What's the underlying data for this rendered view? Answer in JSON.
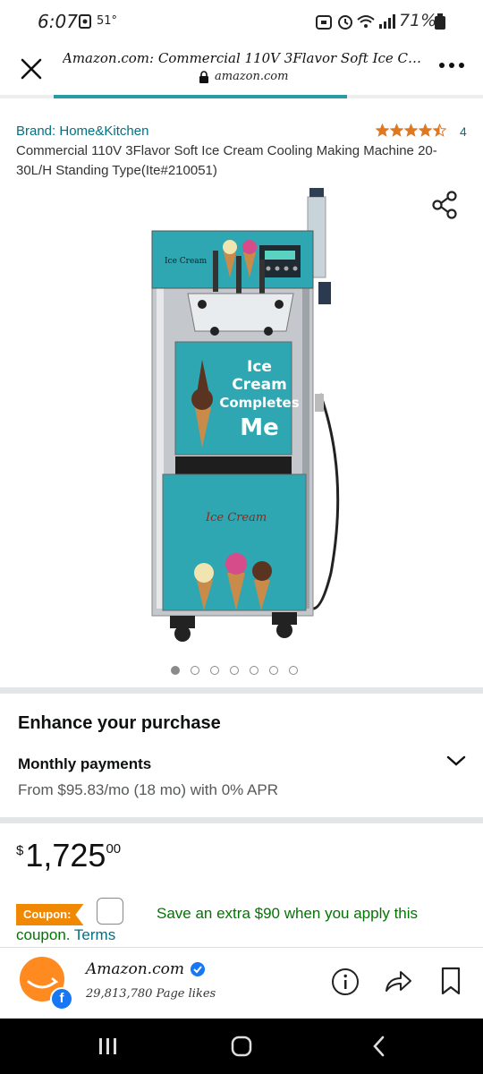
{
  "status_bar": {
    "time": "6:07",
    "temperature": "51°",
    "battery": "71%"
  },
  "browser": {
    "page_title": "Amazon.com: Commercial 110V 3Flavor Soft Ice Cream C...",
    "url": "amazon.com",
    "load_progress": 0.78
  },
  "product": {
    "brand": "Brand: Home&Kitchen",
    "rating_stars": 4.5,
    "rating_count": "4",
    "title": "Commercial 110V 3Flavor Soft Ice Cream Cooling Making Machine 20-30L/H Standing Type(Ite#210051)",
    "image_text": {
      "panel_line1": "Ice",
      "panel_line2": "Cream",
      "panel_line3": "Completes",
      "panel_line4": "Me",
      "logo": "Ice Cream"
    },
    "image_count": 7,
    "active_image_index": 0
  },
  "enhance": {
    "heading": "Enhance your purchase",
    "monthly_label": "Monthly payments",
    "monthly_detail": "From $95.83/mo (18 mo) with 0% APR"
  },
  "price": {
    "currency": "$",
    "whole": "1,725",
    "fraction": "00"
  },
  "coupon": {
    "tag": "Coupon:",
    "text": "Save an extra $90 when you apply this",
    "text2": "coupon.",
    "terms": "Terms"
  },
  "facebook": {
    "page_name": "Amazon.com",
    "likes": "29,813,780 Page likes"
  },
  "colors": {
    "link": "#007185",
    "price_green": "#007600",
    "coupon": "#f08804",
    "star": "#de7921",
    "progress": "#2a9aa6"
  }
}
